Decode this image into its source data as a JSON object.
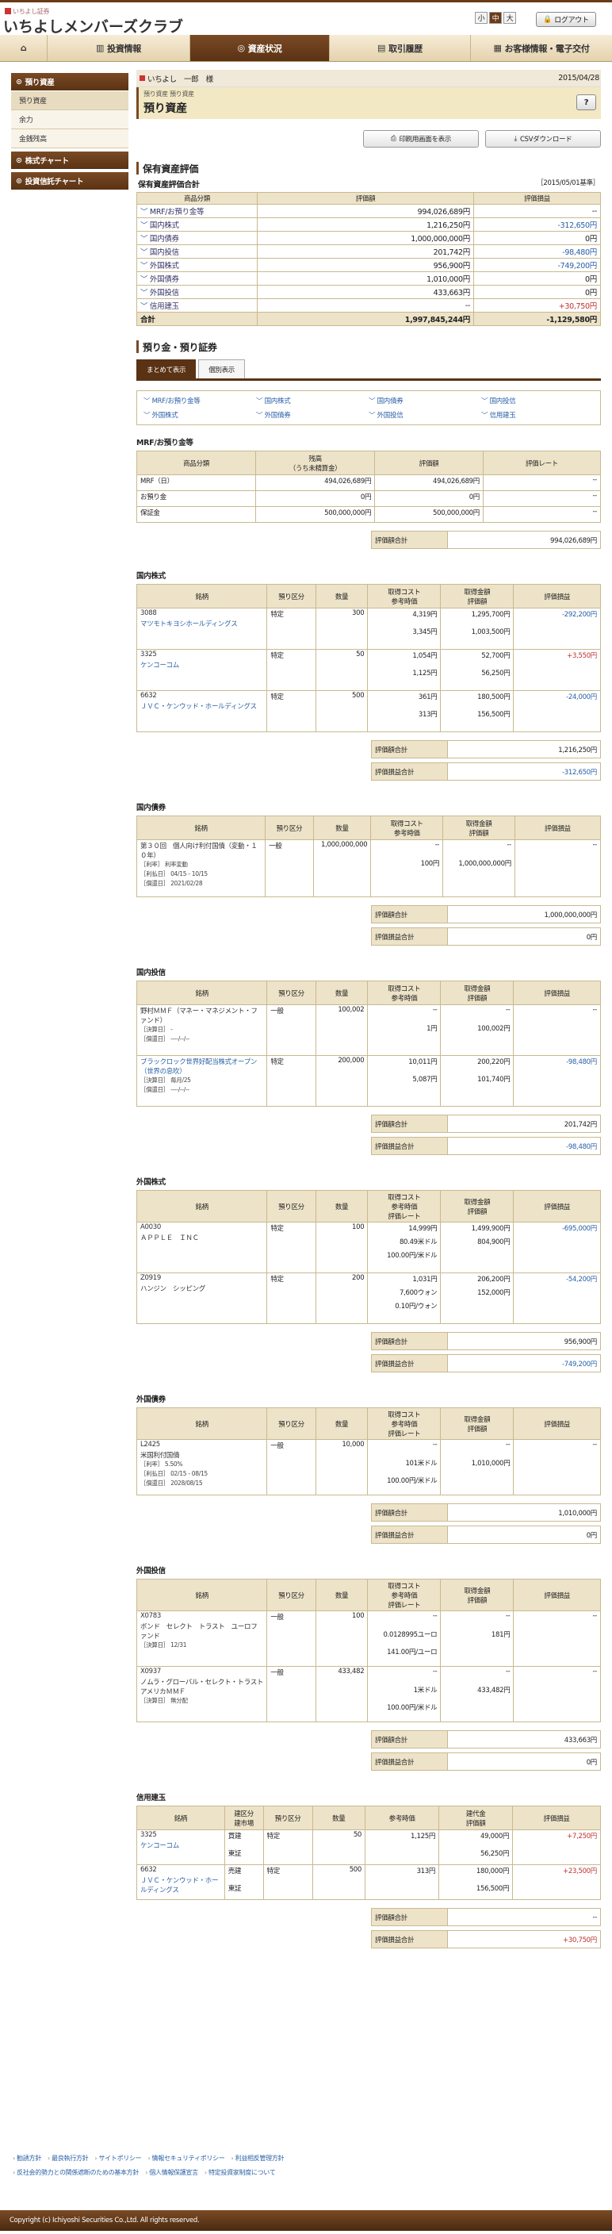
{
  "header": {
    "logo_small": "いちよし証券",
    "logo_main": "いちよしメンバーズクラブ",
    "font_sizes": [
      "小",
      "中",
      "大"
    ],
    "logout": "ログアウト"
  },
  "nav": [
    "",
    "投資情報",
    "資産状況",
    "取引履歴",
    "お客様情報・電子交付"
  ],
  "sidebar": {
    "heading1": "預り資産",
    "items": [
      "預り資産",
      "余力",
      "金銭残高"
    ],
    "heading2": "株式チャート",
    "heading3": "投資信託チャート"
  },
  "crumb": {
    "user": "いちよし　一郎　様",
    "date": "2015/04/28"
  },
  "title": {
    "breadcrumb": "預り資産 預り資産",
    "page": "預り資産",
    "help": "?"
  },
  "buttons": {
    "print": "印刷用画面を表示",
    "csv": "CSVダウンロード"
  },
  "summary": {
    "title": "保有資産評価",
    "subtitle": "保有資産評価合計",
    "basedate": "［2015/05/01基準］",
    "headers": [
      "商品分類",
      "評価額",
      "評価損益"
    ],
    "rows": [
      [
        "MRF/お預り金等",
        "994,026,689円",
        "--"
      ],
      [
        "国内株式",
        "1,216,250円",
        "-312,650円"
      ],
      [
        "国内債券",
        "1,000,000,000円",
        "0円"
      ],
      [
        "国内投信",
        "201,742円",
        "-98,480円"
      ],
      [
        "外国株式",
        "956,900円",
        "-749,200円"
      ],
      [
        "外国債券",
        "1,010,000円",
        "0円"
      ],
      [
        "外国投信",
        "433,663円",
        "0円"
      ],
      [
        "信用建玉",
        "--",
        "+30,750円"
      ]
    ],
    "total": [
      "合計",
      "1,997,845,244円",
      "-1,129,580円"
    ]
  },
  "deposit": {
    "title": "預り金・預り証券",
    "tabs": [
      "まとめて表示",
      "個別表示"
    ],
    "links": [
      "MRF/お預り金等",
      "国内株式",
      "国内債券",
      "国内投信",
      "外国株式",
      "外国債券",
      "外国投信",
      "信用建玉"
    ]
  },
  "mrf": {
    "title": "MRF/お預り金等",
    "headers": [
      "商品分類",
      "残高\n（うち未精算金）",
      "評価額",
      "評価レート"
    ],
    "rows": [
      [
        "MRF（日）",
        "494,026,689円",
        "494,026,689円",
        "--"
      ],
      [
        "お預り金",
        "0円",
        "0円",
        "--"
      ],
      [
        "保証金",
        "500,000,000円",
        "500,000,000円",
        "--"
      ]
    ],
    "total_label": "評価額合計",
    "total": "994,026,689円"
  },
  "dstock": {
    "title": "国内株式",
    "headers": [
      "銘柄",
      "預り区分",
      "数量",
      "取得コスト\n参考時価",
      "取得金額\n評価額",
      "評価損益"
    ],
    "rows": [
      [
        "3088",
        "マツモトキヨシホールディングス",
        "特定",
        "300",
        "4,319円",
        "1,295,700円",
        "3,345円",
        "1,003,500円",
        "-292,200円"
      ],
      [
        "3325",
        "ケンコーコム",
        "特定",
        "50",
        "1,054円",
        "52,700円",
        "1,125円",
        "56,250円",
        "+3,550円"
      ],
      [
        "6632",
        "ＪＶＣ・ケンウッド・ホールディングス",
        "特定",
        "500",
        "361円",
        "180,500円",
        "313円",
        "156,500円",
        "-24,000円"
      ]
    ],
    "total1_label": "評価額合計",
    "total1": "1,216,250円",
    "total2_label": "評価損益合計",
    "total2": "-312,650円"
  },
  "dbond": {
    "title": "国内債券",
    "headers": [
      "銘柄",
      "預り区分",
      "数量",
      "取得コスト\n参考時価",
      "取得金額\n評価額",
      "評価損益"
    ],
    "row": [
      "第３０回　個人向け利付国債（変動・１０年）",
      "［利率］ 利率変動",
      "［利払日］ 04/15 - 10/15",
      "［償還日］ 2021/02/28",
      "一般",
      "1,000,000,000",
      "--",
      "--",
      "100円",
      "1,000,000,000円",
      "--"
    ],
    "total1_label": "評価額合計",
    "total1": "1,000,000,000円",
    "total2_label": "評価損益合計",
    "total2": "0円"
  },
  "dfund": {
    "title": "国内投信",
    "headers": [
      "銘柄",
      "預り区分",
      "数量",
      "取得コスト\n参考時価",
      "取得金額\n評価額",
      "評価損益"
    ],
    "rows": [
      [
        "野村ＭＭＦ（マネー・マネジメント・ファンド）",
        "［決算日］ -",
        "［償還日］ ----/--/--",
        "一般",
        "100,002",
        "--",
        "--",
        "1円",
        "100,002円",
        "--"
      ],
      [
        "ブラックロック世界好配当株式オープン（世界の息吹）",
        "［決算日］ 毎月/25",
        "［償還日］ ----/--/--",
        "特定",
        "200,000",
        "10,011円",
        "200,220円",
        "5,087円",
        "101,740円",
        "-98,480円"
      ]
    ],
    "total1_label": "評価額合計",
    "total1": "201,742円",
    "total2_label": "評価損益合計",
    "total2": "-98,480円"
  },
  "fstock": {
    "title": "外国株式",
    "headers": [
      "銘柄",
      "預り区分",
      "数量",
      "取得コスト\n参考時価\n評価レート",
      "取得金額\n評価額",
      "評価損益"
    ],
    "rows": [
      [
        "A0030",
        "ＡＰＰＬＥ　ＩＮＣ",
        "特定",
        "100",
        "14,999円",
        "1,499,900円",
        "80.49米ドル",
        "804,900円",
        "100.00円/米ドル",
        "-695,000円"
      ],
      [
        "Z0919",
        "ハンジン　シッピング",
        "特定",
        "200",
        "1,031円",
        "206,200円",
        "7,600ウォン",
        "152,000円",
        "0.10円/ウォン",
        "-54,200円"
      ]
    ],
    "total1_label": "評価額合計",
    "total1": "956,900円",
    "total2_label": "評価損益合計",
    "total2": "-749,200円"
  },
  "fbond": {
    "title": "外国債券",
    "headers": [
      "銘柄",
      "預り区分",
      "数量",
      "取得コスト\n参考時価\n評価レート",
      "取得金額\n評価額",
      "評価損益"
    ],
    "row": [
      "L2425",
      "米国利付国債",
      "［利率］ 5.50%",
      "［利払日］ 02/15 - 08/15",
      "［償還日］ 2028/08/15",
      "一般",
      "10,000",
      "--",
      "--",
      "101米ドル",
      "1,010,000円",
      "100.00円/米ドル",
      "--"
    ],
    "total1_label": "評価額合計",
    "total1": "1,010,000円",
    "total2_label": "評価損益合計",
    "total2": "0円"
  },
  "ffund": {
    "title": "外国投信",
    "headers": [
      "銘柄",
      "預り区分",
      "数量",
      "取得コスト\n参考時価\n評価レート",
      "取得金額\n評価額",
      "評価損益"
    ],
    "rows": [
      [
        "X0783",
        "ボンド　セレクト　トラスト　ユーロファンド",
        "［決算日］ 12/31",
        "一般",
        "100",
        "--",
        "--",
        "0.0128995ユーロ",
        "181円",
        "141.00円/ユーロ",
        "--"
      ],
      [
        "X0937",
        "ノムラ・グローバル・セレクト・トラスト　アメリカＭＭＦ",
        "［決算日］ 無分配",
        "一般",
        "433,482",
        "--",
        "--",
        "1米ドル",
        "433,482円",
        "100.00円/米ドル",
        "--"
      ]
    ],
    "total1_label": "評価額合計",
    "total1": "433,663円",
    "total2_label": "評価損益合計",
    "total2": "0円"
  },
  "margin": {
    "title": "信用建玉",
    "headers": [
      "銘柄",
      "建区分\n建市場",
      "預り区分",
      "数量",
      "参考時価",
      "建代金\n評価額",
      "評価損益"
    ],
    "rows": [
      [
        "3325",
        "ケンコーコム",
        "買建",
        "東証",
        "特定",
        "50",
        "1,125円",
        "49,000円",
        "56,250円",
        "+7,250円"
      ],
      [
        "6632",
        "ＪＶＣ・ケンウッド・ホールディングス",
        "売建",
        "東証",
        "特定",
        "500",
        "313円",
        "180,000円",
        "156,500円",
        "+23,500円"
      ]
    ],
    "total1_label": "評価額合計",
    "total1": "--",
    "total2_label": "評価損益合計",
    "total2": "+30,750円"
  },
  "footer": {
    "links1": [
      "勧誘方針",
      "最良執行方針",
      "サイトポリシー",
      "情報セキュリティポリシー",
      "利益相反管理方針"
    ],
    "links2": [
      "反社会的勢力との関係遮断のための基本方針",
      "個人情報保護宣言",
      "特定投資家制度について"
    ],
    "copyright": "Copyright (c) Ichiyoshi Securities Co.,Ltd. All rights reserved."
  },
  "colors": {
    "brown": "#5a3214",
    "beige": "#ede3c8",
    "red": "#c03030",
    "blue": "#2a60a6"
  }
}
